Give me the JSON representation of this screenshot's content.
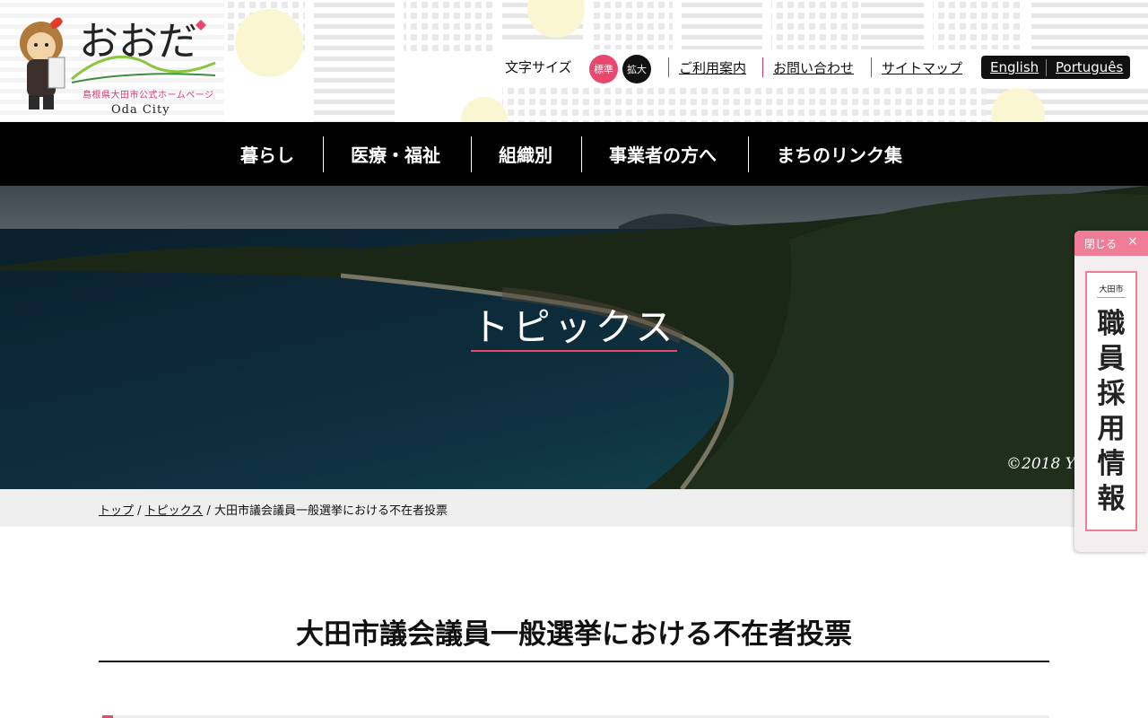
{
  "header": {
    "logo_text": "おおだ",
    "logo_subtitle": "島根県大田市公式ホームページ",
    "logo_en": "Oda City",
    "font_size_label": "文字サイズ",
    "font_size_standard": "標準",
    "font_size_large": "拡大",
    "links": [
      "ご利用案内",
      "お問い合わせ",
      "サイトマップ"
    ],
    "languages": [
      "English",
      "Português"
    ]
  },
  "nav": {
    "items": [
      "暮らし",
      "医療・福祉",
      "組織別",
      "事業者の方へ",
      "まちのリンク集"
    ]
  },
  "hero": {
    "title": "トピックス",
    "copyright": "©2018 Y"
  },
  "breadcrumb": {
    "top": "トップ",
    "topics": "トピックス",
    "sep": " / ",
    "current": "大田市議会議員一般選挙における不在者投票"
  },
  "page": {
    "title": "大田市議会議員一般選挙における不在者投票"
  },
  "banner": {
    "close_label": "閉じる",
    "close_icon": "×",
    "city": "大田市",
    "text": "職員採用情報"
  },
  "colors": {
    "accent": "#e8476e",
    "banner_pink": "#ef7d98",
    "nav_bg": "#000000"
  }
}
